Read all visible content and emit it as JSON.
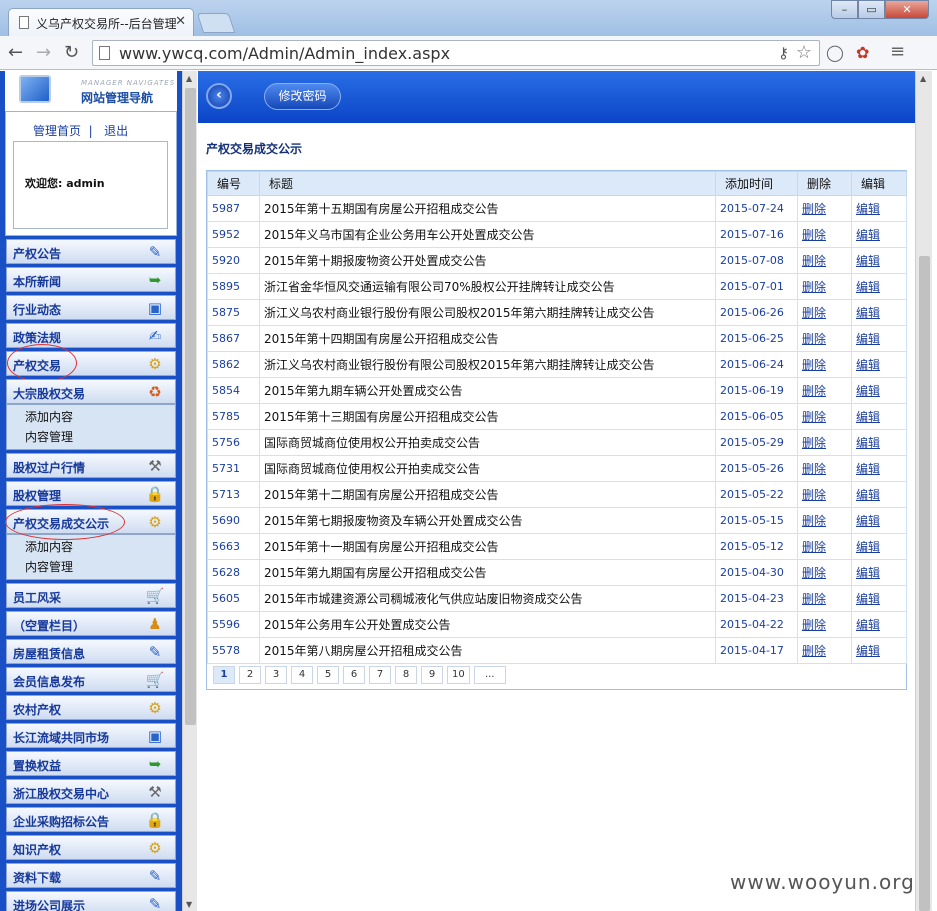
{
  "browser": {
    "tab_title": "义乌产权交易所--后台管理",
    "url": "www.ywcq.com/Admin/Admin_index.aspx"
  },
  "nav_header": {
    "en_title": "MANAGER NAVIGATES",
    "cn_title": "网站管理导航"
  },
  "user_panel": {
    "home_link": "管理首页",
    "separator": "|",
    "logout_link": "退出",
    "welcome": "欢迎您: admin"
  },
  "menu": [
    {
      "label": "产权公告",
      "icon": "notepad-icon"
    },
    {
      "label": "本所新闻",
      "icon": "green-arrow-icon"
    },
    {
      "label": "行业动态",
      "icon": "picture-icon"
    },
    {
      "label": "政策法规",
      "icon": "pen-paper-icon"
    },
    {
      "label": "产权交易",
      "icon": "gear-hand-icon",
      "circled": true
    },
    {
      "label": "大宗股权交易",
      "icon": "recycle-icon",
      "sub": [
        "添加内容",
        "内容管理"
      ]
    },
    {
      "label": "股权过户行情",
      "icon": "tools-icon"
    },
    {
      "label": "股权管理",
      "icon": "lock-icon"
    },
    {
      "label": "产权交易成交公示",
      "icon": "gears-icon",
      "circled": true,
      "sub": [
        "添加内容",
        "内容管理"
      ]
    },
    {
      "label": "员工风采",
      "icon": "cart-icon"
    },
    {
      "label": "（空置栏目）",
      "icon": "person-icon"
    },
    {
      "label": "房屋租赁信息",
      "icon": "notepad-icon"
    },
    {
      "label": "会员信息发布",
      "icon": "cart-icon"
    },
    {
      "label": "农村产权",
      "icon": "gears-icon"
    },
    {
      "label": "长江流域共同市场",
      "icon": "picture-icon"
    },
    {
      "label": "置换权益",
      "icon": "green-arrow-icon"
    },
    {
      "label": "浙江股权交易中心",
      "icon": "tools-icon"
    },
    {
      "label": "企业采购招标公告",
      "icon": "lock-icon"
    },
    {
      "label": "知识产权",
      "icon": "gears-icon"
    },
    {
      "label": "资料下载",
      "icon": "notepad-icon"
    },
    {
      "label": "进场公司展示",
      "icon": "notepad-icon"
    }
  ],
  "toolbar": {
    "back_label": "‹",
    "change_password": "修改密码"
  },
  "page_heading": "产权交易成交公示",
  "table": {
    "headers": [
      "编号",
      "标题",
      "添加时间",
      "删除",
      "编辑"
    ],
    "delete_label": "删除",
    "edit_label": "编辑",
    "rows": [
      {
        "id": "5987",
        "title": "2015年第十五期国有房屋公开招租成交公告",
        "date": "2015-07-24"
      },
      {
        "id": "5952",
        "title": "2015年义乌市国有企业公务用车公开处置成交公告",
        "date": "2015-07-16"
      },
      {
        "id": "5920",
        "title": "2015年第十期报废物资公开处置成交公告",
        "date": "2015-07-08"
      },
      {
        "id": "5895",
        "title": "浙江省金华恒风交通运输有限公司70%股权公开挂牌转让成交公告",
        "date": "2015-07-01"
      },
      {
        "id": "5875",
        "title": "浙江义乌农村商业银行股份有限公司股权2015年第六期挂牌转让成交公告",
        "date": "2015-06-26"
      },
      {
        "id": "5867",
        "title": "2015年第十四期国有房屋公开招租成交公告",
        "date": "2015-06-25"
      },
      {
        "id": "5862",
        "title": "浙江义乌农村商业银行股份有限公司股权2015年第六期挂牌转让成交公告",
        "date": "2015-06-24"
      },
      {
        "id": "5854",
        "title": "2015年第九期车辆公开处置成交公告",
        "date": "2015-06-19"
      },
      {
        "id": "5785",
        "title": "2015年第十三期国有房屋公开招租成交公告",
        "date": "2015-06-05"
      },
      {
        "id": "5756",
        "title": "国际商贸城商位使用权公开拍卖成交公告",
        "date": "2015-05-29"
      },
      {
        "id": "5731",
        "title": "国际商贸城商位使用权公开拍卖成交公告",
        "date": "2015-05-26"
      },
      {
        "id": "5713",
        "title": "2015年第十二期国有房屋公开招租成交公告",
        "date": "2015-05-22"
      },
      {
        "id": "5690",
        "title": "2015年第七期报废物资及车辆公开处置成交公告",
        "date": "2015-05-15"
      },
      {
        "id": "5663",
        "title": "2015年第十一期国有房屋公开招租成交公告",
        "date": "2015-05-12"
      },
      {
        "id": "5628",
        "title": "2015年第九期国有房屋公开招租成交公告",
        "date": "2015-04-30"
      },
      {
        "id": "5605",
        "title": "2015年市城建资源公司稠城液化气供应站废旧物资成交公告",
        "date": "2015-04-23"
      },
      {
        "id": "5596",
        "title": "2015年公务用车公开处置成交公告",
        "date": "2015-04-22"
      },
      {
        "id": "5578",
        "title": "2015年第八期房屋公开招租成交公告",
        "date": "2015-04-17"
      }
    ]
  },
  "pager": {
    "pages": [
      "1",
      "2",
      "3",
      "4",
      "5",
      "6",
      "7",
      "8",
      "9",
      "10"
    ],
    "more": "...",
    "current": "1"
  },
  "watermark": "www.wooyun.org",
  "colors": {
    "nav_blue": "#1a50c6",
    "link_blue": "#1a3ea0",
    "annotation_red": "#e03030"
  }
}
